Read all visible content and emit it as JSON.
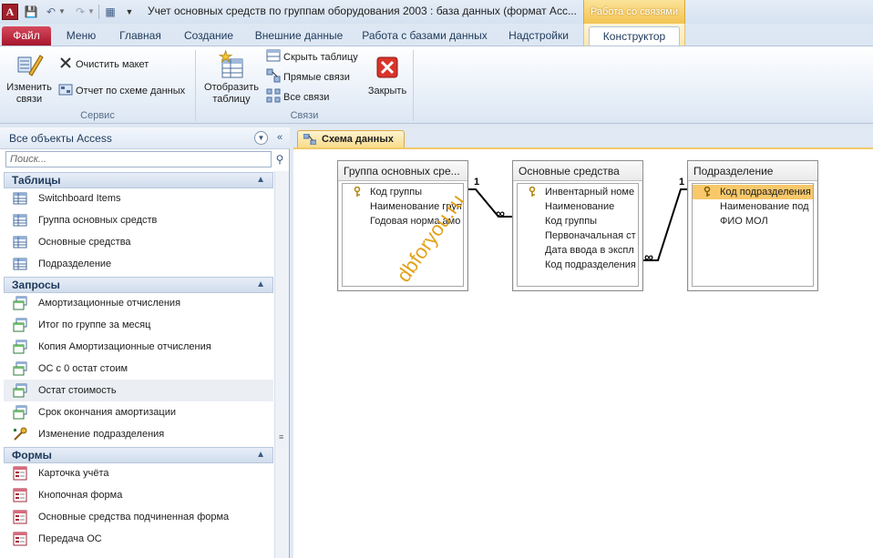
{
  "title_bar": {
    "window_title": "Учет основных средств по группам оборудования 2003 : база данных (формат Acc...",
    "context_group": "Работа со связями",
    "app_icon_letter": "A"
  },
  "tabs": [
    {
      "label": "Файл"
    },
    {
      "label": "Меню"
    },
    {
      "label": "Главная"
    },
    {
      "label": "Создание"
    },
    {
      "label": "Внешние данные"
    },
    {
      "label": "Работа с базами данных"
    },
    {
      "label": "Надстройки"
    },
    {
      "label": "Конструктор"
    }
  ],
  "ribbon": {
    "service": {
      "label": "Сервис",
      "edit_relations": "Изменить связи",
      "clear_layout": "Очистить макет",
      "relationship_report": "Отчет по схеме данных"
    },
    "relations": {
      "label": "Связи",
      "show_table": "Отобразить таблицу",
      "hide_table": "Скрыть таблицу",
      "direct_relations": "Прямые связи",
      "all_relations": "Все связи",
      "close": "Закрыть"
    }
  },
  "nav": {
    "title": "Все объекты Access",
    "search_placeholder": "Поиск...",
    "sections": [
      {
        "label": "Таблицы",
        "items": [
          "Switchboard Items",
          "Группа основных средств",
          "Основные средства",
          "Подразделение"
        ]
      },
      {
        "label": "Запросы",
        "items": [
          "Амортизационные отчисления",
          "Итог по группе за месяц",
          "Копия Амортизационные отчисления",
          "ОС с 0 остат стоим",
          "Остат стоимость",
          "Срок окончания амортизации",
          "Изменение подразделения"
        ]
      },
      {
        "label": "Формы",
        "items": [
          "Карточка учёта",
          "Кнопочная форма",
          "Основные средства подчиненная форма",
          "Передача ОС"
        ]
      }
    ]
  },
  "document": {
    "tab_label": "Схема данных",
    "tables": [
      {
        "title": "Группа основных сре...",
        "fields": [
          "Код группы",
          "Наименование груп",
          "Годовая норма амо"
        ]
      },
      {
        "title": "Основные средства",
        "fields": [
          "Инвентарный номе",
          "Наименование",
          "Код группы",
          "Первоначальная ст",
          "Дата ввода в экспл",
          "Код подразделения"
        ]
      },
      {
        "title": "Подразделение",
        "fields": [
          "Код подразделения",
          "Наименование под",
          "ФИО МОЛ"
        ]
      }
    ],
    "relation_one": "1",
    "relation_many": "∞"
  },
  "watermark": "dbforyou.ru",
  "colors": {
    "file_tab": "#c21f3a",
    "context_tab": "#f4c453",
    "highlight_field": "#f8c86a",
    "key": "#e8b530"
  }
}
